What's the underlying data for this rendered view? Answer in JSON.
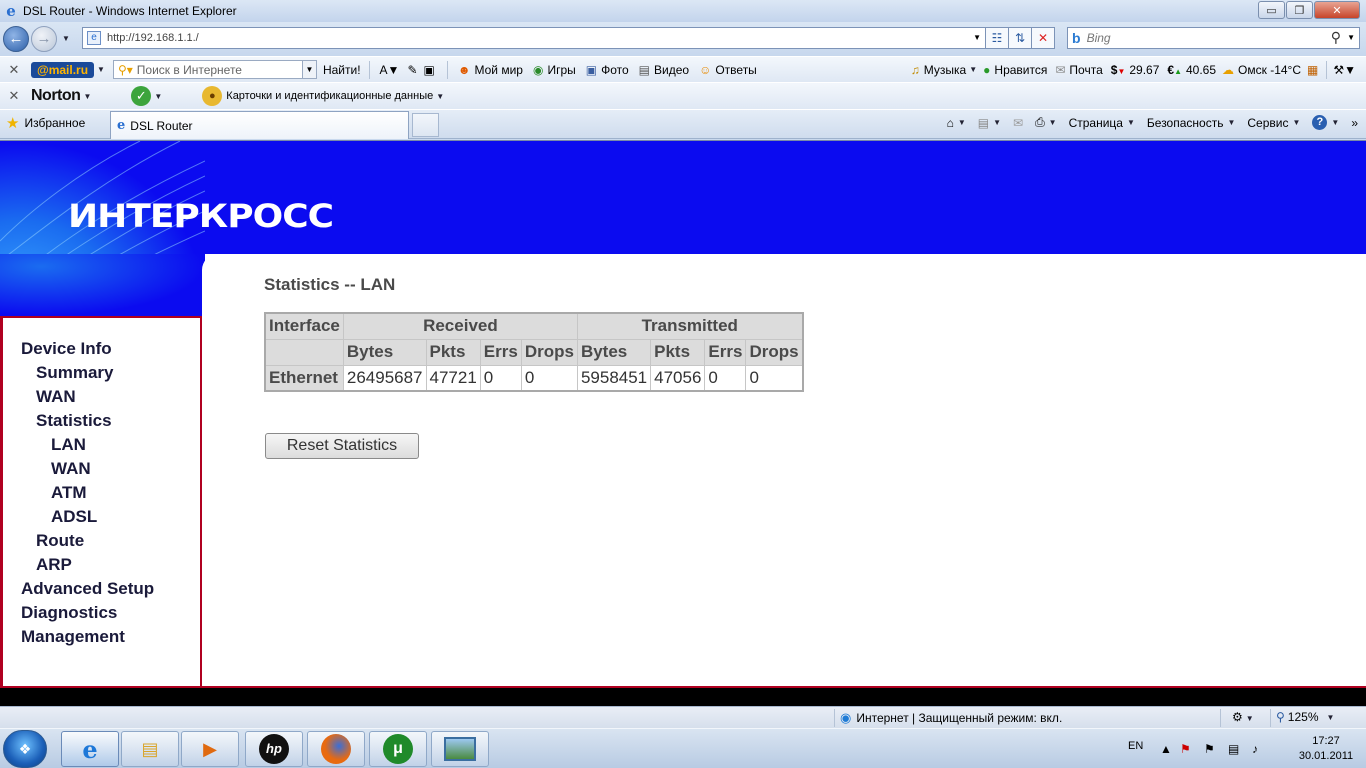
{
  "window": {
    "title": "DSL Router - Windows Internet Explorer",
    "minimize": "▭",
    "restore": "❐",
    "close": "✕"
  },
  "address": {
    "url": "http://192.168.1.1./",
    "search_placeholder": "Bing"
  },
  "mailru_toolbar": {
    "logo": "@mail.ru",
    "search_placeholder": "Поиск в Интернете",
    "find_label": "Найти!",
    "links": [
      "Мой мир",
      "Игры",
      "Фото",
      "Видео",
      "Ответы"
    ],
    "right": {
      "music": "Музыка",
      "like": "Нравится",
      "mail": "Почта",
      "usd": "29.67",
      "eur": "40.65",
      "weather": "Омск -14°C"
    }
  },
  "norton_toolbar": {
    "logo": "Norton",
    "cards_label": "Карточки и идентификационные данные"
  },
  "tabs": {
    "favorites": "Избранное",
    "active_tab": "DSL Router"
  },
  "command_bar": {
    "page": "Страница",
    "safety": "Безопасность",
    "tools": "Сервис"
  },
  "router": {
    "brand": "ИНТЕРКРОСС",
    "page_title": "Statistics -- LAN",
    "nav": [
      "Device Info",
      "Summary",
      "WAN",
      "Statistics",
      "LAN",
      "WAN",
      "ATM",
      "ADSL",
      "Route",
      "ARP",
      "Advanced Setup",
      "Diagnostics",
      "Management"
    ],
    "table": {
      "headers": {
        "interface": "Interface",
        "received": "Received",
        "transmitted": "Transmitted",
        "sub": [
          "Bytes",
          "Pkts",
          "Errs",
          "Drops",
          "Bytes",
          "Pkts",
          "Errs",
          "Drops"
        ]
      },
      "rows": [
        {
          "name": "Ethernet",
          "values": [
            "26495687",
            "47721",
            "0",
            "0",
            "5958451",
            "47056",
            "0",
            "0"
          ]
        }
      ]
    },
    "reset_button": "Reset Statistics"
  },
  "status": {
    "zone": "Интернет | Защищенный режим: вкл.",
    "zoom": "125%"
  },
  "taskbar": {
    "lang": "EN",
    "time": "17:27",
    "date": "30.01.2011"
  },
  "colors": {
    "banner": "#0b0bf0",
    "sidebar_border": "#b00020",
    "table_header": "#dcdcdc"
  }
}
